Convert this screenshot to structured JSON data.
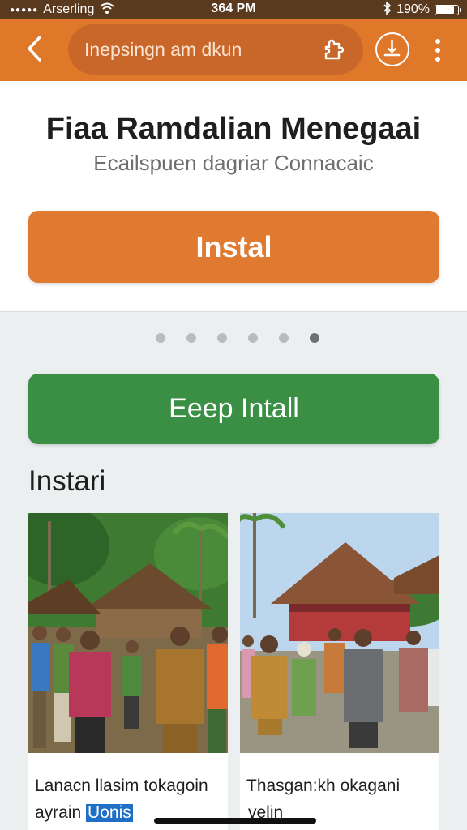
{
  "status_bar": {
    "carrier": "Arserling",
    "time": "364 PM",
    "battery": "190%",
    "battery_level": 0.9,
    "icons": [
      "signal-dots-icon",
      "wifi-icon",
      "bluetooth-icon",
      "battery-icon"
    ]
  },
  "app_bar": {
    "search_text": "Inepsingn  am dkun",
    "icons": [
      "back-chevron-icon",
      "puzzle-icon",
      "download-icon",
      "more-vert-icon"
    ]
  },
  "header": {
    "title": "Fiaa Ramdalian Menegaai",
    "subtitle": "Ecailspuen dagriar Connacaic",
    "install_label": "Instal"
  },
  "carousel": {
    "count": 6,
    "active_index": 5
  },
  "keep_install_label": "Eeep Intall",
  "section_title": "Instari",
  "cards": [
    {
      "caption_line1": "Lanacn llasim tokagoin",
      "caption_line2_text": "ayrain",
      "tag": "Uonis"
    },
    {
      "caption_line1": "Thasgan:kh okagani",
      "caption_line2_text": "",
      "tag": "velin"
    }
  ],
  "colors": {
    "status_bar": "#5a3a1e",
    "app_bar": "#e0782a",
    "install": "#e07a30",
    "keep_install": "#3b8f45",
    "tag_blue": "#1f6fc7"
  }
}
